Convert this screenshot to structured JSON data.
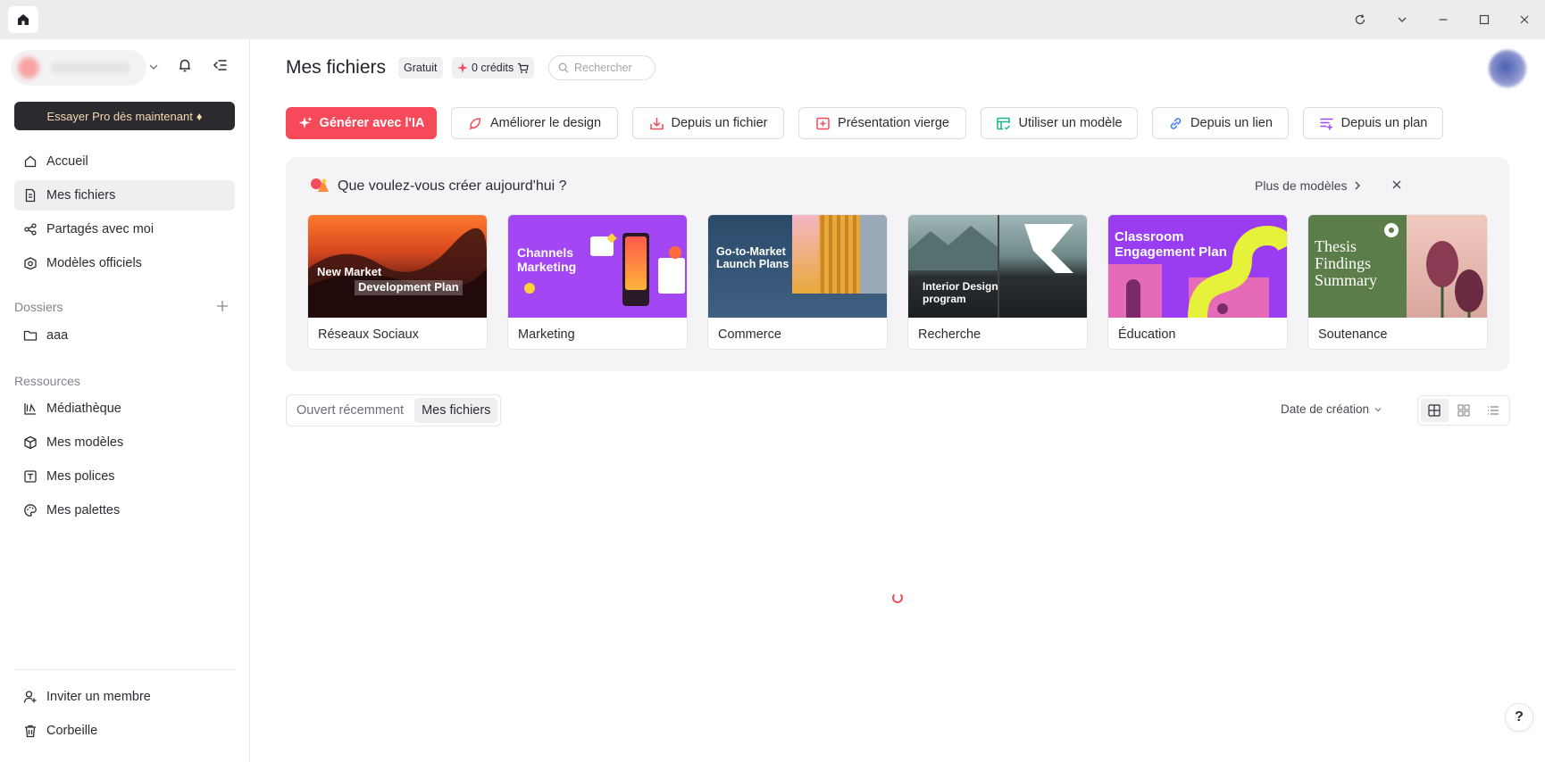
{
  "sidebar": {
    "pro_button": "Essayer Pro dès maintenant",
    "nav": [
      {
        "label": "Accueil",
        "icon": "home-icon"
      },
      {
        "label": "Mes fichiers",
        "icon": "file-icon"
      },
      {
        "label": "Partagés avec moi",
        "icon": "share-icon"
      },
      {
        "label": "Modèles officiels",
        "icon": "template-icon"
      }
    ],
    "folders_label": "Dossiers",
    "folders": [
      {
        "label": "aaa",
        "icon": "folder-icon"
      }
    ],
    "resources_label": "Ressources",
    "resources": [
      {
        "label": "Médiathèque",
        "icon": "media-icon"
      },
      {
        "label": "Mes modèles",
        "icon": "cube-icon"
      },
      {
        "label": "Mes polices",
        "icon": "font-icon"
      },
      {
        "label": "Mes palettes",
        "icon": "palette-icon"
      }
    ],
    "footer": [
      {
        "label": "Inviter un membre",
        "icon": "invite-icon"
      },
      {
        "label": "Corbeille",
        "icon": "trash-icon"
      }
    ]
  },
  "header": {
    "title": "Mes fichiers",
    "plan_badge": "Gratuit",
    "credits": "0 crédits",
    "search_placeholder": "Rechercher"
  },
  "actions": [
    {
      "label": "Générer avec l'IA",
      "icon": "sparkle-icon"
    },
    {
      "label": "Améliorer le design",
      "icon": "rocket-icon"
    },
    {
      "label": "Depuis un fichier",
      "icon": "import-icon"
    },
    {
      "label": "Présentation vierge",
      "icon": "blank-icon"
    },
    {
      "label": "Utiliser un modèle",
      "icon": "model-icon"
    },
    {
      "label": "Depuis un lien",
      "icon": "link-icon"
    },
    {
      "label": "Depuis un plan",
      "icon": "outline-icon"
    }
  ],
  "templates_panel": {
    "title": "Que voulez-vous créer aujourd'hui ?",
    "more_label": "Plus de modèles",
    "cards": [
      {
        "label": "Réseaux Sociaux",
        "thumb_text_1": "New Market",
        "thumb_text_2": "Development Plan"
      },
      {
        "label": "Marketing",
        "thumb_text_1": "Channels Marketing"
      },
      {
        "label": "Commerce",
        "thumb_text_1": "Go-to-Market Launch Plans"
      },
      {
        "label": "Recherche",
        "thumb_text_1": "Interior Design program"
      },
      {
        "label": "Éducation",
        "thumb_text_1": "Classroom Engagement Plan"
      },
      {
        "label": "Soutenance",
        "thumb_text_1": "Thesis Findings Summary"
      }
    ]
  },
  "files": {
    "tabs": [
      "Ouvert récemment",
      "Mes fichiers"
    ],
    "active_tab": "Mes fichiers",
    "sort_label": "Date de création"
  },
  "help_label": "?",
  "colors": {
    "accent": "#f64a5b",
    "pro_bg": "#2b2b2f",
    "pro_text": "#f5d9b0"
  }
}
